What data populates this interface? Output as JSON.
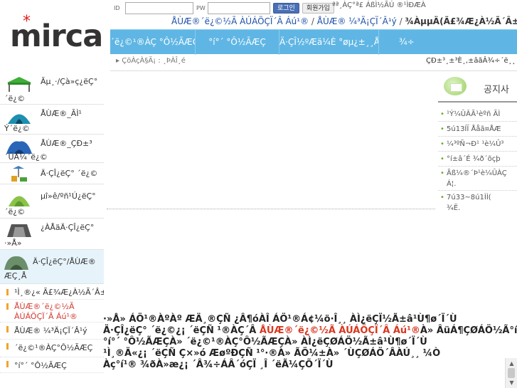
{
  "brand": {
    "logo_text": "mirca",
    "logo_star": "*",
    "accent": "#e0201b",
    "menu_color": "#5fb6e4"
  },
  "login": {
    "id_label": "ID",
    "pw_label": "PW",
    "login_label": "로그인",
    "join_label": "회원가입"
  },
  "top_links": "ªª¸ÀÇ°ª£ ÁßÌ½ÃÚ ®¹ÌÐÆÀ",
  "subnav": {
    "item1": "ÅÙÆ®´ë¿©½Ã ÀÚÁÖÇÏ´Â Áú¹®",
    "sep": " / ",
    "item2": "ÅÙÆ® ¼³Ä¡ÇÏ´Â¹ý",
    "sep2": " / ",
    "item3": "¾ÀµµÄ(Ã£¾Æ¿À½Ã´Â±æ"
  },
  "main_menu": [
    "´ë¿©¹®ÀÇ °Ô½ÃÆÇ",
    "°í°´ °Ô½ÃÆÇ",
    "Ä·ÇÎ½ºÆä¼È °øµ¿±¸¸Å",
    "¾÷"
  ],
  "breadcrumb": {
    "arrow": "▸",
    "label": "ÇöÀçÀ§Ä¡ : ¸ÞÀÎ¸é"
  },
  "breadcrumb_right": "ÇÐ±³¸±³È¸,±âãÂ¾÷´ë¸¸",
  "notice": {
    "title": "공지사",
    "items": [
      "¹Ý¼ÛÂÃ¹èºñ ÃÌ",
      "5ú13ÍÏ Ååã¤ÅÆ",
      "¼³ºÑ¬Ð¹ ¹è¼Û³",
      "°í±â´É ¾ð´õçþ",
      "Ãß¼®´Þ¹è¼ÛÀÇ",
      "Á¦.",
      "7ú33~8ú1ÌÌ(",
      "¾Ë."
    ]
  },
  "sidebar": {
    "categories": [
      {
        "line1": "Ãµ¸·/Çà»ç¿ëÇ°",
        "line2": "´ë¿©",
        "icon": "canopy-tent-icon"
      },
      {
        "line1": "ÅÙÆ®_ÃÌ¹",
        "line2": "Ý´ë¿©",
        "icon": "dome-tent-icon"
      },
      {
        "line1": "ÅÙÆ®_ÇÐ±³",
        "line2": "´ÜÃ¼´ë¿©",
        "icon": "tunnel-tent-icon"
      },
      {
        "line1": "Ä·ÇÎ¿ëÇ° ´ë¿©",
        "line2": "",
        "icon": "camping-gear-icon"
      },
      {
        "line1": "µî»ê/ºñ¹Ú¿ëÇ°",
        "line2": "´ë¿©",
        "icon": "hiking-gear-icon"
      },
      {
        "line1": "¿ÀÅäÄ·ÇÎ¿ëÇ°",
        "line2": "·»Å»",
        "icon": "auto-camping-icon"
      },
      {
        "line1": "Ä·ÇÎ¿ëÇ°/ÅÙÆ®",
        "line2": "ÆÇ¸Å",
        "icon": "shop-tent-icon"
      }
    ],
    "sub_items": [
      {
        "label": "¹Ì¸®¿« Ã£¾Æ¿À½Ã´Â±æ",
        "red": false
      },
      {
        "label": "ÅÙÆ®´ë¿©½Ã ÀÚÁÖÇÏ´Â Áú¹®",
        "red": true
      },
      {
        "label": "ÅÙÆ® ¼³Ä¡ÇÏ´Â¹ý",
        "red": false
      },
      {
        "label": "´ë¿©¹®ÀÇ°Ô½ÃÆÇ",
        "red": false
      },
      {
        "label": "°í°´ °Ô½ÃÆÇ",
        "red": false
      }
    ]
  },
  "content": {
    "line1a": "·»Å» ÁÖ¹®ÀºÀº ÆÄ¸®ÇÑ ¿Â¶óÀÎ ÁÖ¹®Á¢¼ö·Î¸¸ ÀÌ¿ëÇÏ½Ã±â¹Ù¶ø´Ï´Ù",
    "line2a": "Ä·ÇÎ¿ëÇ° ´ë¿©¿¡ ´ëÇÑ ¹®ÀÇ´Â ",
    "line2b": "ÅÙÆ®´ë¿©½Ã ÀÚÁÖÇÏ´Â Áú¹®",
    "line2c": "À» ÂüÁ¶ÇØÁÖ½Ã°í",
    "line3": "°í°´ °Ô½ÃÆÇÀ» ´ë¿©¹®ÀÇ°Ô½ÃÆÇÀ» ÀÌ¿ëÇØÁÖ½Ã±â¹Ù¶ø´Ï´Ù",
    "line4": "¹Ì¸®Ä«¿¡ ´ëÇÑ Ç×»ó ÆøºÐÇÑ ¹°·®À» ÃÖ¼±À» ´ÙÇØÁÖ´ÂÀÚ¸¸ ¼Ò",
    "line5": "Àç°í¹® ¾ðÀ»æ¿¡ ´Â¾÷ÁÂ´óÇÏ ¸Î ´ëÃ¼ÇÕ´Ï´Ù"
  },
  "scroll": {
    "up": "▲",
    "down": "▼"
  }
}
